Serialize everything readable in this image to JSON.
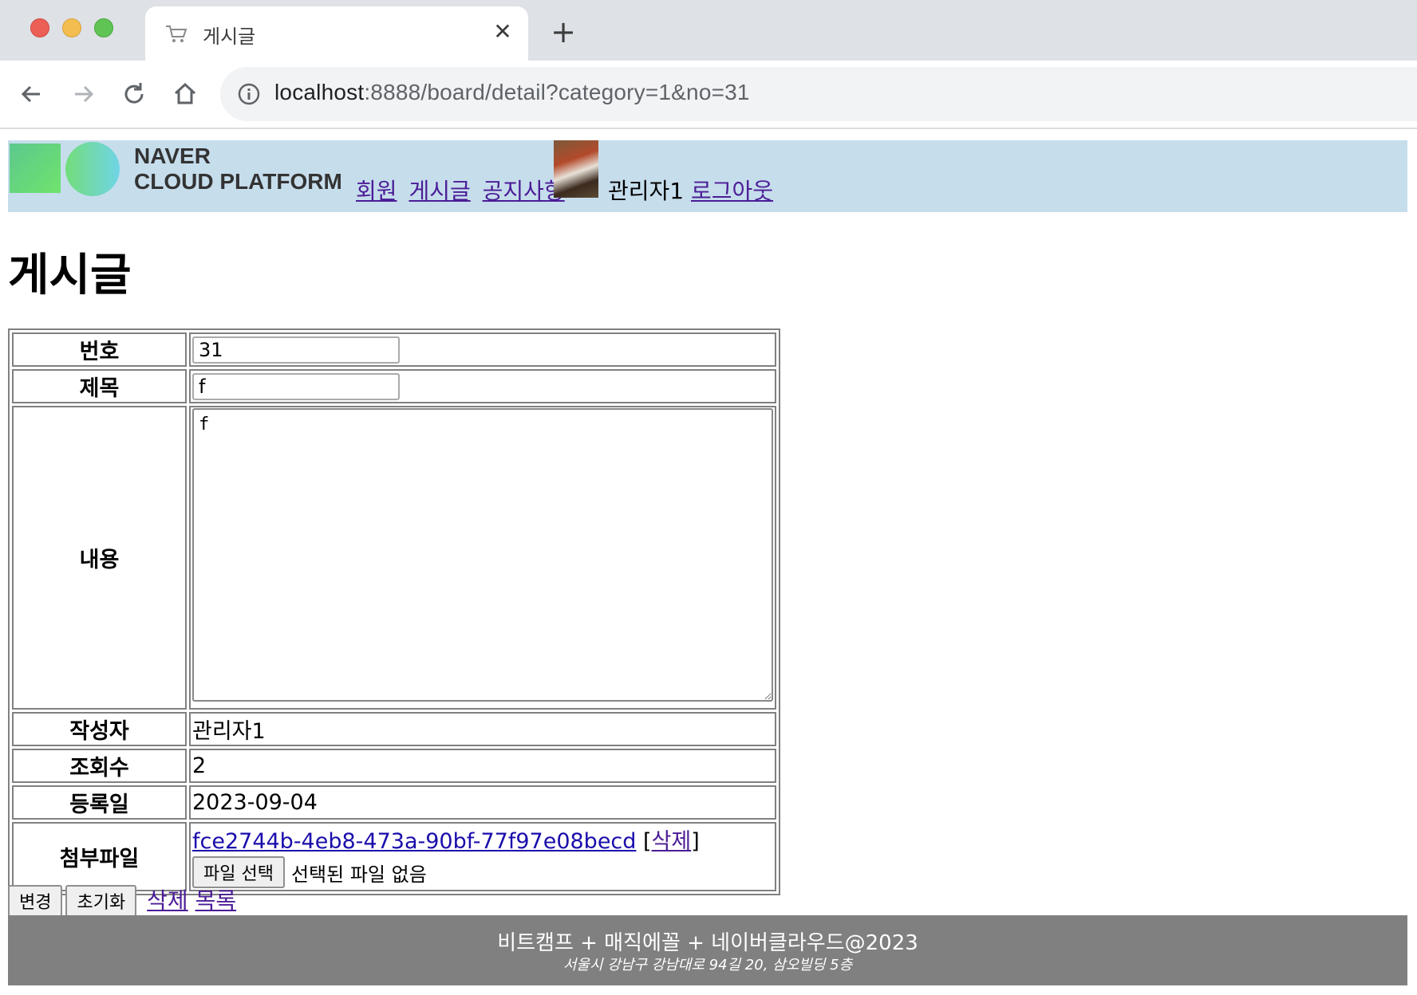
{
  "browser": {
    "tab_title": "게시글",
    "url_host": "localhost",
    "url_rest": ":8888/board/detail?category=1&no=31"
  },
  "header": {
    "logo_line1": "NAVER",
    "logo_line2": "CLOUD PLATFORM",
    "menu": [
      "회원",
      "게시글",
      "공지사항"
    ],
    "user_name": "관리자1",
    "logout_label": "로그아웃"
  },
  "page_title": "게시글",
  "form": {
    "labels": {
      "no": "번호",
      "title": "제목",
      "content": "내용",
      "writer": "작성자",
      "views": "조회수",
      "date": "등록일",
      "attachment": "첨부파일"
    },
    "no_value": "31",
    "title_value": "f",
    "content_value": "f",
    "writer_value": "관리자1",
    "views_value": "2",
    "date_value": "2023-09-04",
    "attachment": {
      "file_name": "fce2744b-4eb8-473a-90bf-77f97e08becd",
      "open_bracket": "[",
      "delete_label": "삭제",
      "close_bracket": "]",
      "choose_label": "파일 선택",
      "status": "선택된 파일 없음"
    }
  },
  "actions": {
    "update": "변경",
    "reset": "초기화",
    "delete": "삭제",
    "list": "목록"
  },
  "footer": {
    "main": "비트캠프 + 매직에꼴 + 네이버클라우드@2023",
    "address": "서울시 강남구 강남대로 94길 20, 삼오빌딩 5층"
  }
}
